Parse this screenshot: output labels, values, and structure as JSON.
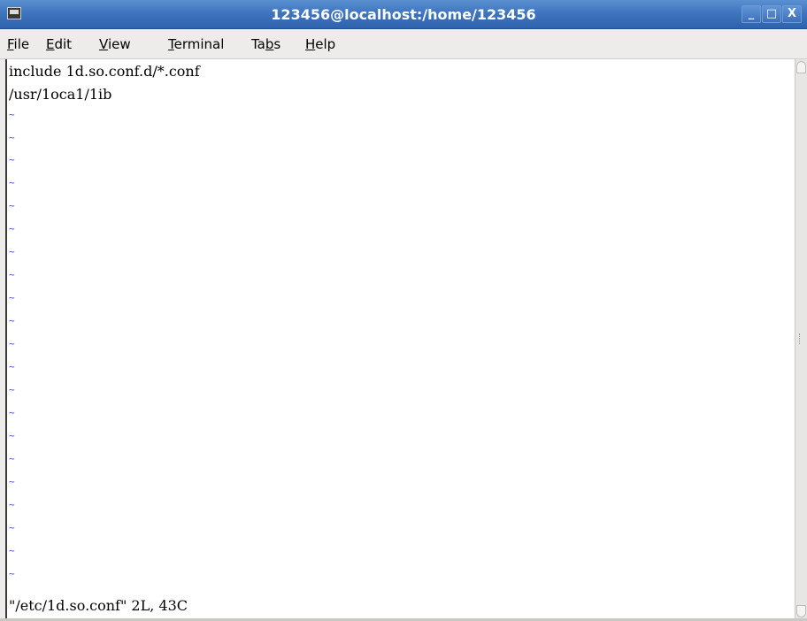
{
  "window": {
    "title": "123456@localhost:/home/123456"
  },
  "titlebar_buttons": {
    "minimize": "_",
    "maximize": "□",
    "close": "X"
  },
  "menu": {
    "file": {
      "accel": "F",
      "rest": "ile"
    },
    "edit": {
      "accel": "E",
      "rest": "dit"
    },
    "view": {
      "accel": "V",
      "rest": "iew"
    },
    "terminal": {
      "accel": "T",
      "rest": "erminal"
    },
    "tabs": {
      "pre": "Ta",
      "accel": "b",
      "rest": "s"
    },
    "help": {
      "accel": "H",
      "rest": "elp"
    }
  },
  "editor": {
    "lines": [
      "include 1d.so.conf.d/*.conf",
      "/usr/1oca1/1ib"
    ],
    "tilde": "~",
    "status": "\"/etc/1d.so.conf\" 2L, 43C"
  }
}
